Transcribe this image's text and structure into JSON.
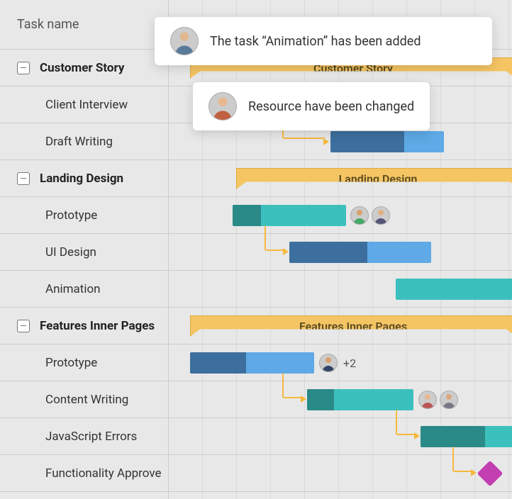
{
  "header": {
    "task_name_col": "Task name"
  },
  "groups": [
    {
      "label": "Customer Story",
      "bar_label": "Customer Story",
      "children": [
        {
          "label": "Client Interview"
        },
        {
          "label": "Draft Writing"
        }
      ]
    },
    {
      "label": "Landing Design",
      "bar_label": "Landing Design",
      "children": [
        {
          "label": "Prototype"
        },
        {
          "label": "UI Design"
        },
        {
          "label": "Animation"
        }
      ]
    },
    {
      "label": "Features Inner Pages",
      "bar_label": "Features Inner Pages",
      "children": [
        {
          "label": "Prototype",
          "more_count": "+2"
        },
        {
          "label": "Content Writing"
        },
        {
          "label": "JavaScript Errors"
        },
        {
          "label": "Functionality Approve"
        }
      ]
    }
  ],
  "notifications": [
    {
      "message": "The task “Animation” has been added"
    },
    {
      "message": "Resource have been changed"
    }
  ],
  "colors": {
    "group_bar": "#f5c563",
    "blue": "#5ea9e6",
    "blue_dark": "#3d6f9e",
    "teal": "#3cc0bd",
    "teal_dark": "#2a8a88",
    "milestone": "#c33eb0",
    "connector": "#f5b93e"
  }
}
